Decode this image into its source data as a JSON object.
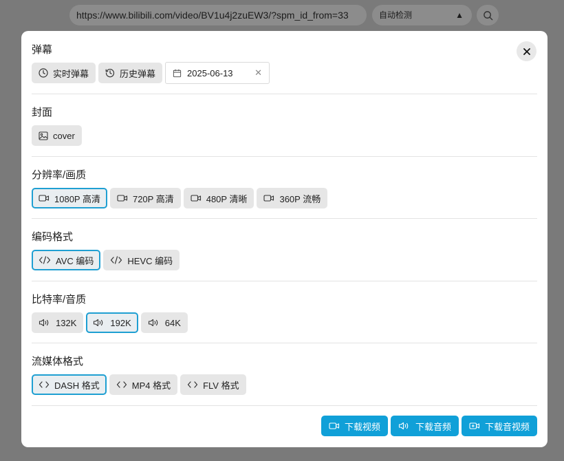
{
  "topbar": {
    "url": "https://www.bilibili.com/video/BV1u4j2zuEW3/?spm_id_from=33",
    "detect_label": "自动检测",
    "detect_caret": "▲"
  },
  "danmaku": {
    "title": "弹幕",
    "realtime_label": "实时弹幕",
    "history_label": "历史弹幕",
    "date_value": "2025-06-13",
    "clear_symbol": "✕"
  },
  "cover": {
    "title": "封面",
    "button_label": "cover"
  },
  "resolution": {
    "title": "分辨率/画质",
    "options": [
      "1080P 高清",
      "720P 高清",
      "480P 清晰",
      "360P 流畅"
    ],
    "selected": "1080P 高清"
  },
  "codec": {
    "title": "编码格式",
    "options": [
      "AVC 编码",
      "HEVC 编码"
    ],
    "selected": "AVC 编码"
  },
  "bitrate": {
    "title": "比特率/音质",
    "options": [
      "132K",
      "192K",
      "64K"
    ],
    "selected": "192K"
  },
  "stream": {
    "title": "流媒体格式",
    "options": [
      "DASH 格式",
      "MP4 格式",
      "FLV 格式"
    ],
    "selected": "DASH 格式"
  },
  "footer": {
    "download_video": "下载视频",
    "download_audio": "下载音频",
    "download_both": "下载音视频"
  },
  "colors": {
    "accent": "#10a0d8",
    "selected_border": "#1e9fd2",
    "chip_bg": "#e6e6e6",
    "backdrop": "#7a7a7a"
  },
  "icons": {
    "close": "close-icon",
    "realtime": "clock-icon",
    "history": "history-icon",
    "calendar": "calendar-icon",
    "cover": "image-icon",
    "resolution": "video-camera-icon",
    "codec": "code-icon",
    "bitrate": "speaker-icon",
    "stream": "chevrons-icon",
    "search": "search-icon"
  }
}
